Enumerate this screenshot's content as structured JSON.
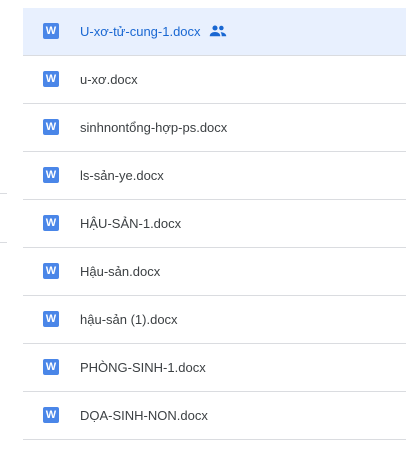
{
  "files": [
    {
      "name": "U-xơ-tử-cung-1.docx",
      "icon": "docs-word-icon",
      "icon_letter": "W",
      "selected": true,
      "shared": true,
      "shared_icon": "people-icon"
    },
    {
      "name": "u-xơ.docx",
      "icon": "docs-word-icon",
      "icon_letter": "W",
      "selected": false,
      "shared": false
    },
    {
      "name": "sinhnontổng-hợp-ps.docx",
      "icon": "docs-word-icon",
      "icon_letter": "W",
      "selected": false,
      "shared": false
    },
    {
      "name": "ls-sản-ye.docx",
      "icon": "docs-word-icon",
      "icon_letter": "W",
      "selected": false,
      "shared": false
    },
    {
      "name": "HẬU-SẢN-1.docx",
      "icon": "docs-word-icon",
      "icon_letter": "W",
      "selected": false,
      "shared": false
    },
    {
      "name": "Hậu-sản.docx",
      "icon": "docs-word-icon",
      "icon_letter": "W",
      "selected": false,
      "shared": false
    },
    {
      "name": "hậu-sản (1).docx",
      "icon": "docs-word-icon",
      "icon_letter": "W",
      "selected": false,
      "shared": false
    },
    {
      "name": "PHÒNG-SINH-1.docx",
      "icon": "docs-word-icon",
      "icon_letter": "W",
      "selected": false,
      "shared": false
    },
    {
      "name": "DỌA-SINH-NON.docx",
      "icon": "docs-word-icon",
      "icon_letter": "W",
      "selected": false,
      "shared": false
    }
  ],
  "colors": {
    "icon_blue": "#4a86e8",
    "selected_background": "#e8f0fe",
    "selected_text": "#1967d2",
    "text": "#3c4043",
    "divider": "#dadce0"
  }
}
